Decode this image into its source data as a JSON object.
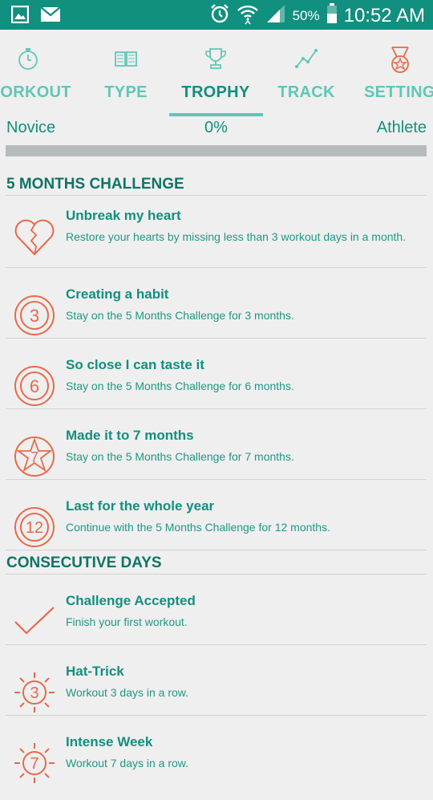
{
  "status_bar": {
    "battery": "50%",
    "time": "10:52 AM"
  },
  "tabs": [
    {
      "label": "WORKOUT",
      "icon": "stopwatch-icon",
      "active": false
    },
    {
      "label": "TYPE",
      "icon": "book-icon",
      "active": false
    },
    {
      "label": "TROPHY",
      "icon": "trophy-icon",
      "active": true
    },
    {
      "label": "TRACK",
      "icon": "line-chart-icon",
      "active": false
    },
    {
      "label": "SETTING",
      "icon": "medal-icon",
      "active": false
    }
  ],
  "progress": {
    "left_label": "Novice",
    "percent_label": "0%",
    "right_label": "Athlete",
    "value": 0
  },
  "sections": [
    {
      "title": "5 MONTHS CHALLENGE",
      "items": [
        {
          "title": "Unbreak my heart",
          "desc": "Restore your hearts by missing less than 3 workout days in a month.",
          "icon": "broken-heart-icon"
        },
        {
          "title": "Creating a habit",
          "desc": "Stay on the 5 Months Challenge for 3 months.",
          "icon": "circle-3-icon",
          "badge": "3"
        },
        {
          "title": "So close I can taste it",
          "desc": "Stay on the 5 Months Challenge for 6 months.",
          "icon": "circle-6-icon",
          "badge": "6"
        },
        {
          "title": "Made it to 7 months",
          "desc": "Stay on the 5 Months Challenge for 7 months.",
          "icon": "star-7-icon",
          "badge": "7"
        },
        {
          "title": "Last for the whole year",
          "desc": "Continue with the 5 Months Challenge for 12 months.",
          "icon": "circle-12-icon",
          "badge": "12"
        }
      ]
    },
    {
      "title": "CONSECUTIVE DAYS",
      "items": [
        {
          "title": "Challenge Accepted",
          "desc": "Finish your first workout.",
          "icon": "checkmark-icon"
        },
        {
          "title": "Hat-Trick",
          "desc": "Workout 3 days in a row.",
          "icon": "sun-3-icon",
          "badge": "3"
        },
        {
          "title": "Intense Week",
          "desc": "Workout 7 days in a row.",
          "icon": "sun-7-icon",
          "badge": "7"
        }
      ]
    }
  ],
  "colors": {
    "accent": "#128f7f",
    "light_accent": "#5fc7b7",
    "icon_orange": "#e8694a",
    "status_bar": "#118f7f"
  }
}
